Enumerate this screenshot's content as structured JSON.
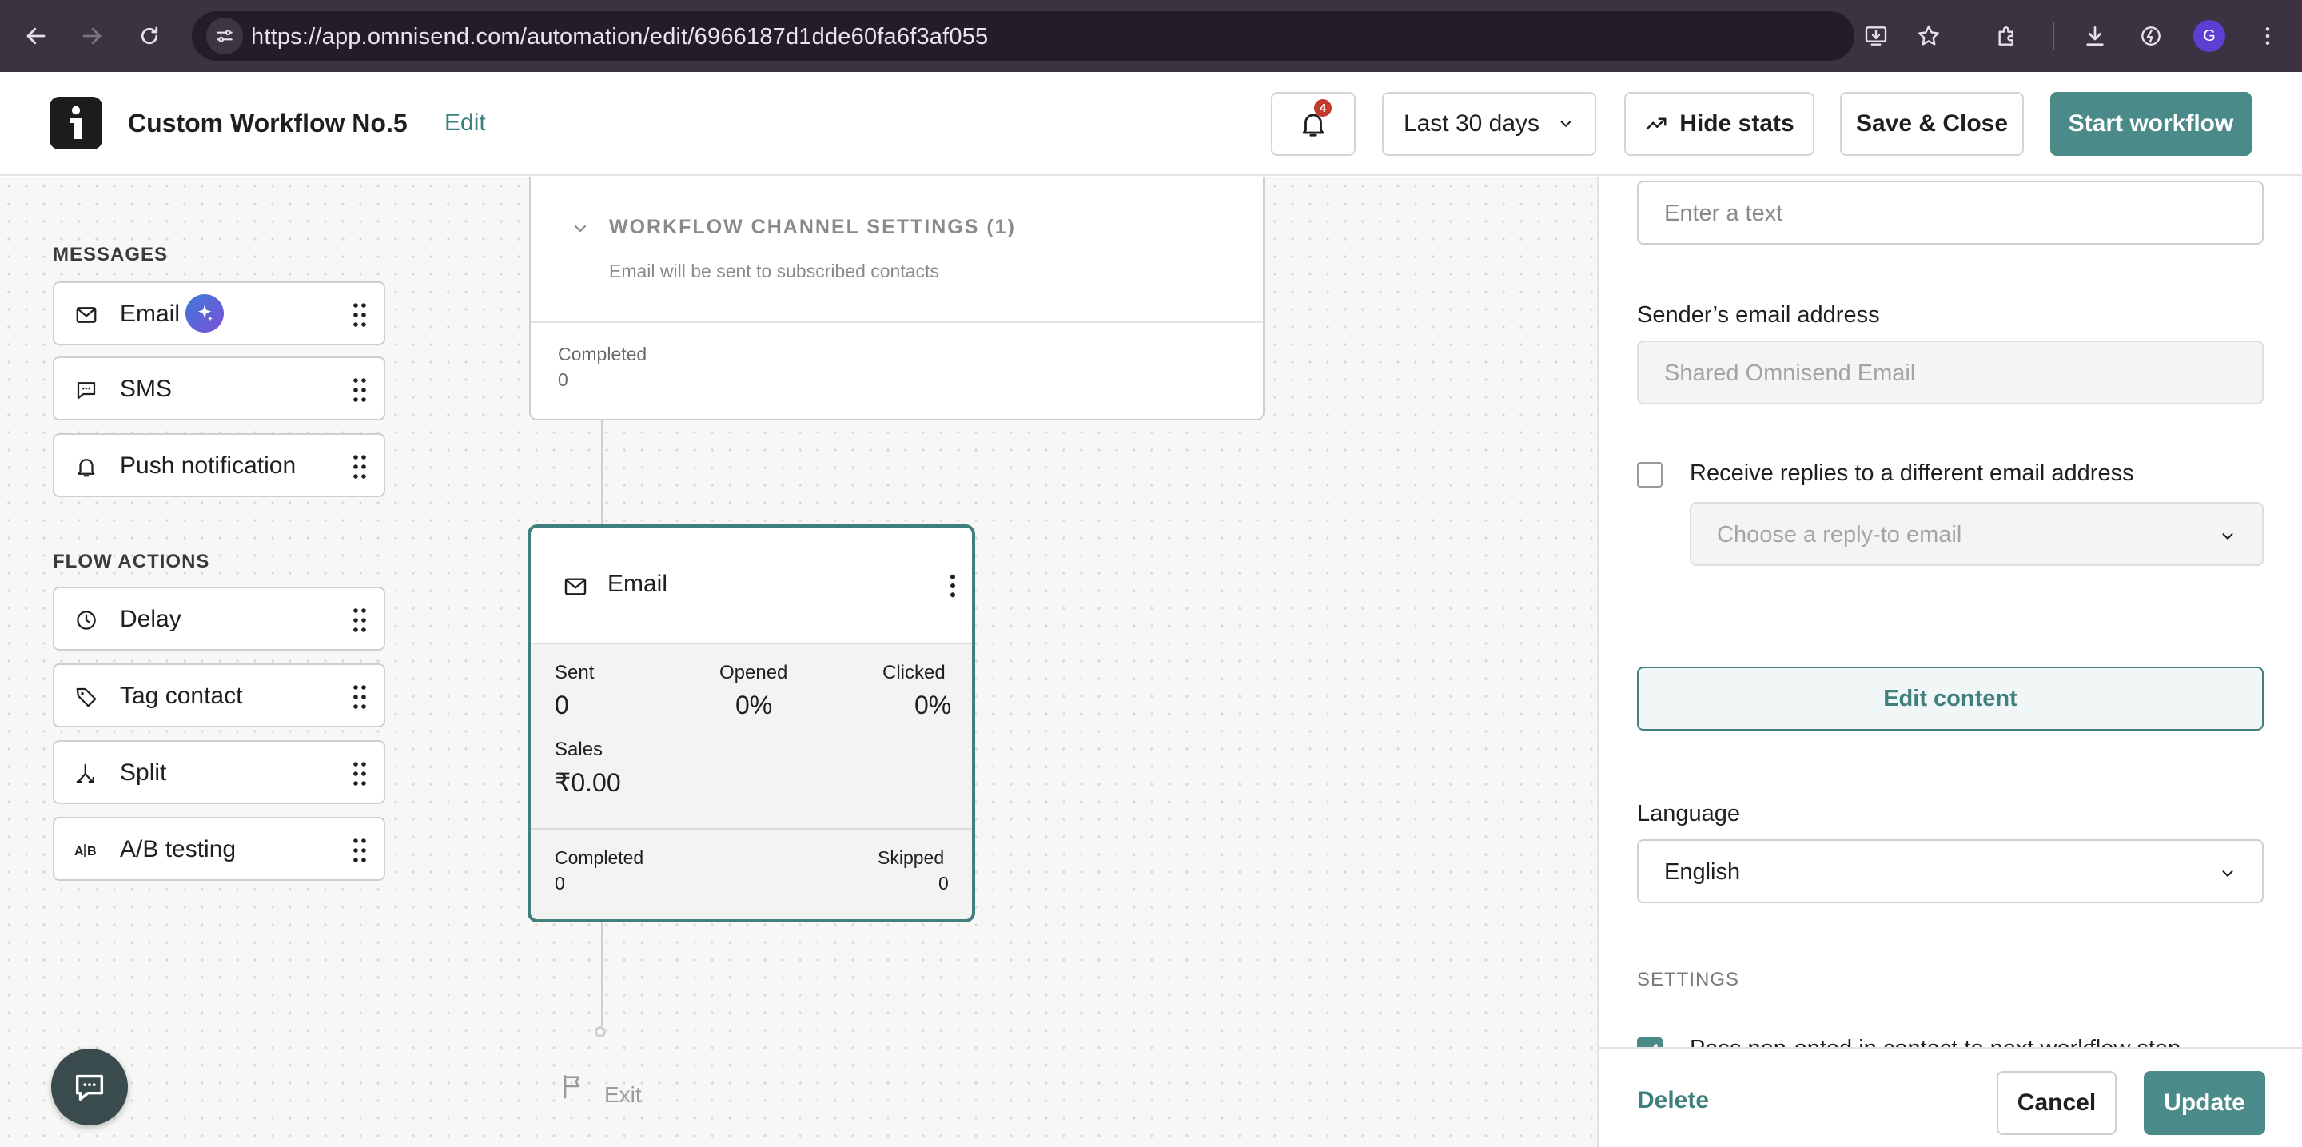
{
  "browser": {
    "url": "https://app.omnisend.com/automation/edit/6966187d1dde60fa6f3af055",
    "profile_initial": "G"
  },
  "header": {
    "title": "Custom Workflow No.5",
    "edit_label": "Edit",
    "notification_count": "4",
    "date_range": "Last 30 days",
    "hide_stats": "Hide stats",
    "save_close": "Save & Close",
    "start_workflow": "Start workflow"
  },
  "palette": {
    "messages_heading": "MESSAGES",
    "messages": [
      {
        "label": "Email",
        "icon": "mail-icon"
      },
      {
        "label": "SMS",
        "icon": "sms-icon"
      },
      {
        "label": "Push notification",
        "icon": "bell-icon"
      }
    ],
    "flow_heading": "FLOW ACTIONS",
    "flow": [
      {
        "label": "Delay",
        "icon": "clock-icon"
      },
      {
        "label": "Tag contact",
        "icon": "tag-icon"
      },
      {
        "label": "Split",
        "icon": "split-icon"
      },
      {
        "label": "A/B testing",
        "icon": "ab-icon"
      }
    ]
  },
  "top_node": {
    "section_title": "WORKFLOW CHANNEL SETTINGS (1)",
    "section_sub": "Email will be sent to subscribed contacts",
    "completed_label": "Completed",
    "completed_value": "0"
  },
  "email_node": {
    "title": "Email",
    "sent_label": "Sent",
    "sent_value": "0",
    "opened_label": "Opened",
    "opened_value": "0%",
    "clicked_label": "Clicked",
    "clicked_value": "0%",
    "sales_label": "Sales",
    "sales_value": "₹0.00",
    "completed_label": "Completed",
    "completed_value": "0",
    "skipped_label": "Skipped",
    "skipped_value": "0"
  },
  "exit": {
    "label": "Exit"
  },
  "panel": {
    "text_placeholder": "Enter a text",
    "sender_label": "Sender’s email address",
    "sender_value": "Shared Omnisend Email",
    "replies_label": "Receive replies to a different email address",
    "reply_placeholder": "Choose a reply-to email",
    "edit_content": "Edit content",
    "language_label": "Language",
    "language_value": "English",
    "settings_heading": "SETTINGS",
    "pass_setting": "Pass non-opted in contact to next workflow step",
    "delete": "Delete",
    "cancel": "Cancel",
    "update": "Update"
  },
  "colors": {
    "accent": "#4a8a88",
    "accent_dark": "#3f7f7d",
    "badge": "#c5382c"
  }
}
